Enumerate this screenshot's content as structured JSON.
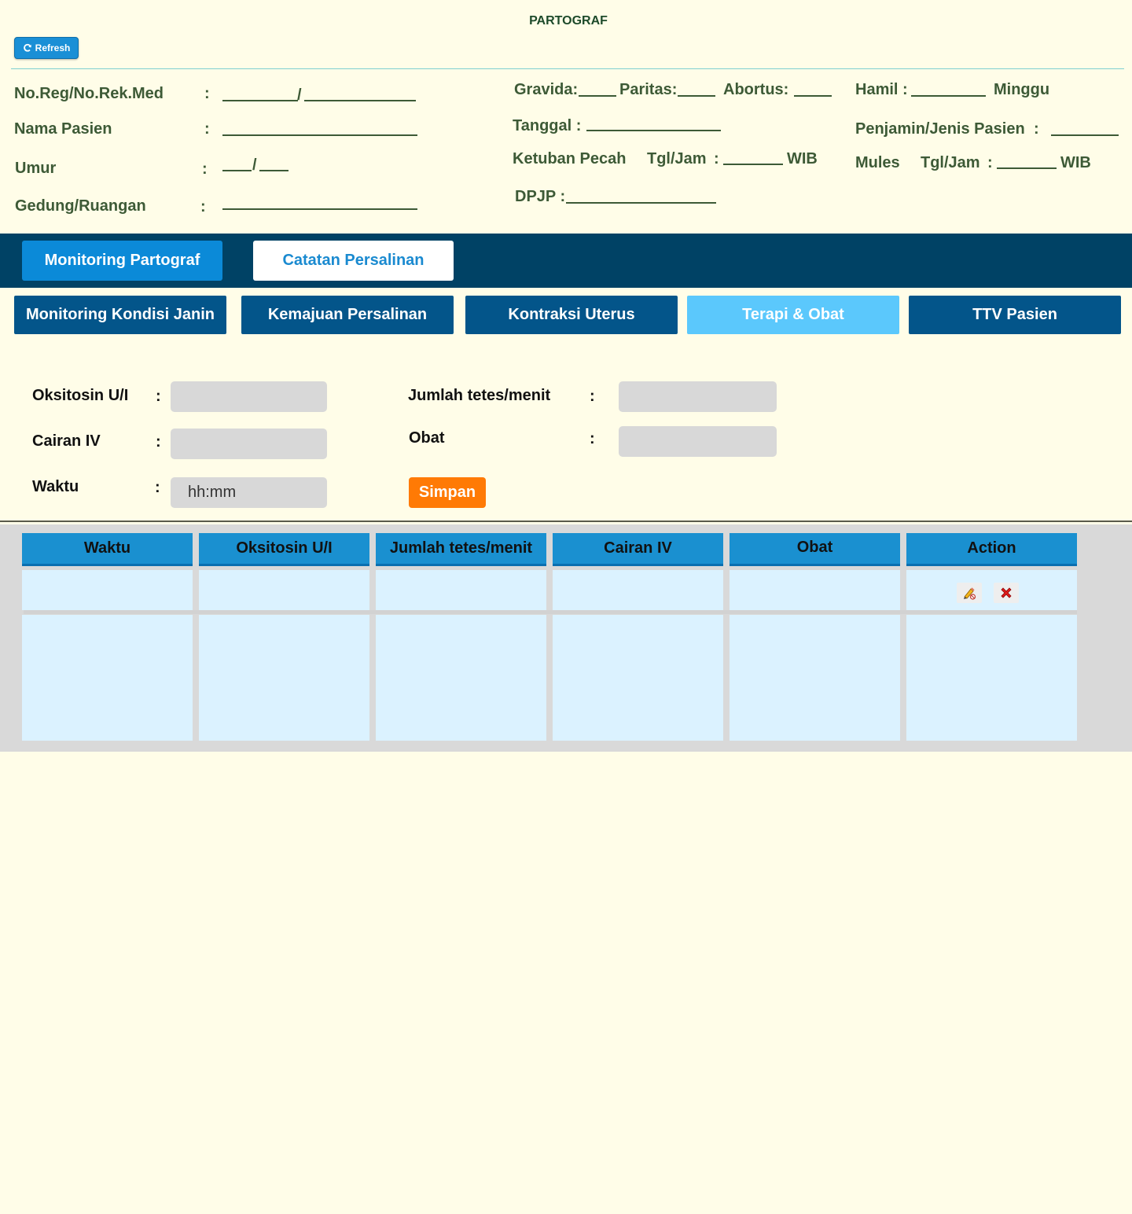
{
  "header": {
    "title": "PARTOGRAF",
    "refresh_label": "Refresh"
  },
  "patient": {
    "no_reg_label": "No.Reg/No.Rek.Med",
    "nama_label": "Nama Pasien",
    "umur_label": "Umur",
    "gedung_label": "Gedung/Ruangan",
    "colon": ":",
    "slash": "/",
    "gravida_label": "Gravida:",
    "paritas_label": "Paritas:",
    "abortus_label": "Abortus:",
    "hamil_label": "Hamil :",
    "minggu_label": "Minggu",
    "tanggal_label": "Tanggal :",
    "penjamin_label": "Penjamin/Jenis Pasien",
    "ketuban_label": "Ketuban Pecah",
    "tgljam_label": "Tgl/Jam",
    "wib_label": "WIB",
    "mules_label": "Mules",
    "dpjp_label": "DPJP :"
  },
  "main_tabs": {
    "monitoring": "Monitoring Partograf",
    "catatan": "Catatan Persalinan"
  },
  "sub_tabs": {
    "janin": "Monitoring  Kondisi Janin",
    "kemajuan": "Kemajuan Persalinan",
    "kontraksi": "Kontraksi Uterus",
    "terapi": "Terapi & Obat",
    "ttv": "TTV Pasien"
  },
  "form": {
    "oksitosin_label": "Oksitosin U/I",
    "cairan_label": "Cairan IV",
    "waktu_label": "Waktu",
    "waktu_placeholder": "hh:mm",
    "jumlah_label": "Jumlah tetes/menit",
    "obat_label": "Obat",
    "simpan_label": "Simpan"
  },
  "table": {
    "headers": [
      "Waktu",
      "Oksitosin U/I",
      "Jumlah tetes/menit",
      "Cairan IV",
      "Obat",
      "Action"
    ],
    "actions": {
      "edit_icon": "pencil-edit-icon",
      "delete_icon": "red-x-delete-icon"
    }
  },
  "colors": {
    "background": "#fffde8",
    "label_green": "#3d5a36",
    "navbar": "#004265",
    "tab_active": "#0b8ad8",
    "subtab": "#03558a",
    "subtab_active": "#5bc8fc",
    "simpan": "#ff7a05",
    "table_header": "#1a90d0",
    "table_cell": "#dbf2ff"
  }
}
